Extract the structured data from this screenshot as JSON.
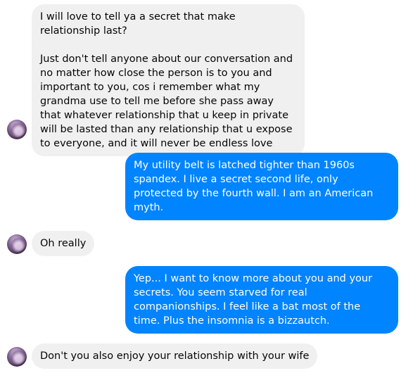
{
  "messages": [
    {
      "sender": "them",
      "text": "I will love to tell ya a secret that make relationship last?\n\nJust don't tell anyone about our conversation and no matter how close the person is to you and important to you, cos i remember what my grandma use to tell me before she pass away that whatever relationship that u keep in private will be lasted than any relationship that u expose to everyone, and it will never be endless love"
    },
    {
      "sender": "me",
      "text": "My utility belt is latched tighter than 1960s spandex. I live a secret second life, only protected by the fourth wall. I am an American myth."
    },
    {
      "sender": "them",
      "text": "Oh really"
    },
    {
      "sender": "me",
      "text": "Yep... I want to know more about you and your secrets. You seem starved for real companionships. I feel like a bat most of the time. Plus the insomnia is a bizzautch."
    },
    {
      "sender": "them",
      "text": "Don't you also enjoy your relationship with your wife"
    }
  ],
  "colors": {
    "incoming_bg": "#f0f0f0",
    "outgoing_bg": "#0084ff"
  }
}
